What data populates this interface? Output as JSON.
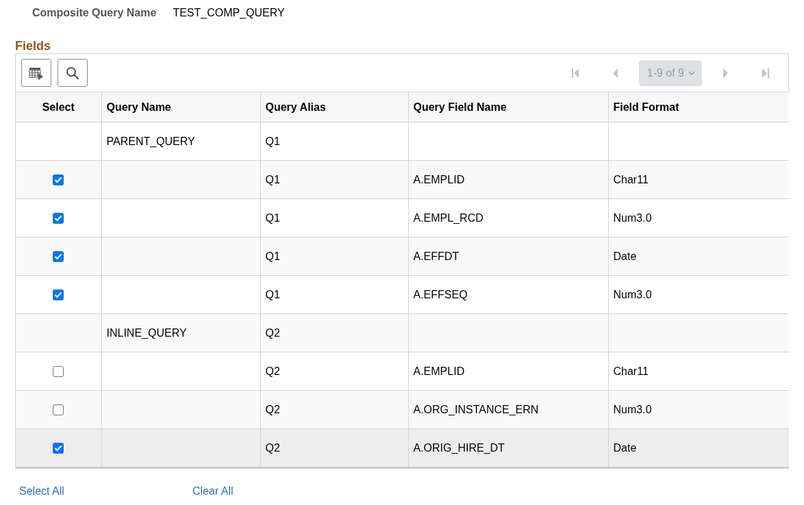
{
  "header": {
    "label": "Composite Query Name",
    "value": "TEST_COMP_QUERY"
  },
  "section_title": "Fields",
  "pagination": {
    "range": "1-9 of 9"
  },
  "table": {
    "columns": [
      "Select",
      "Query Name",
      "Query Alias",
      "Query Field Name",
      "Field Format"
    ],
    "rows": [
      {
        "kind": "query",
        "query_name": "PARENT_QUERY",
        "alias": "Q1",
        "highlighted": false
      },
      {
        "kind": "field",
        "checked": true,
        "alias": "Q1",
        "field_name": "A.EMPLID",
        "format": "Char11",
        "highlighted": false
      },
      {
        "kind": "field",
        "checked": true,
        "alias": "Q1",
        "field_name": "A.EMPL_RCD",
        "format": "Num3.0",
        "highlighted": false
      },
      {
        "kind": "field",
        "checked": true,
        "alias": "Q1",
        "field_name": "A.EFFDT",
        "format": "Date",
        "highlighted": false
      },
      {
        "kind": "field",
        "checked": true,
        "alias": "Q1",
        "field_name": "A.EFFSEQ",
        "format": "Num3.0",
        "highlighted": false
      },
      {
        "kind": "query",
        "query_name": "INLINE_QUERY",
        "alias": "Q2",
        "highlighted": false
      },
      {
        "kind": "field",
        "checked": false,
        "alias": "Q2",
        "field_name": "A.EMPLID",
        "format": "Char11",
        "highlighted": false
      },
      {
        "kind": "field",
        "checked": false,
        "alias": "Q2",
        "field_name": "A.ORG_INSTANCE_ERN",
        "format": "Num3.0",
        "highlighted": false
      },
      {
        "kind": "field",
        "checked": true,
        "alias": "Q2",
        "field_name": "A.ORIG_HIRE_DT",
        "format": "Date",
        "highlighted": true
      }
    ]
  },
  "links": [
    "Select All",
    "Clear All"
  ]
}
